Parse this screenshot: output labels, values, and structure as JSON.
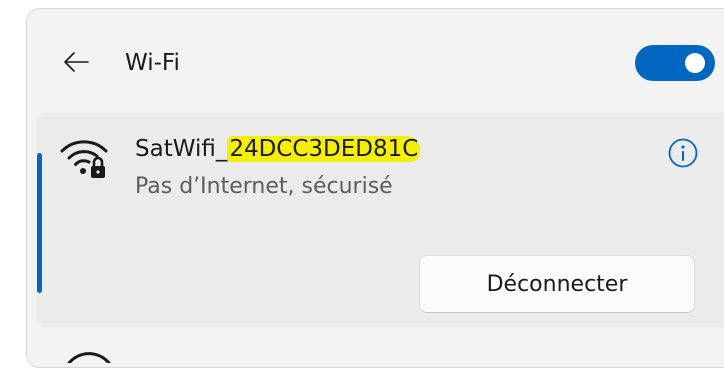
{
  "header": {
    "back_icon": "arrow-left-icon",
    "title": "Wi-Fi",
    "wifi_enabled": true,
    "accent_color": "#0067c0"
  },
  "network": {
    "ssid_prefix": "SatWifi_",
    "ssid_highlighted": "24DCC3DED81C",
    "highlight_color": "#f5f000",
    "status": "Pas d’Internet, sécurisé",
    "signal_icon": "wifi-secured-icon",
    "info_icon": "info-icon",
    "disconnect_label": "Déconnecter"
  }
}
